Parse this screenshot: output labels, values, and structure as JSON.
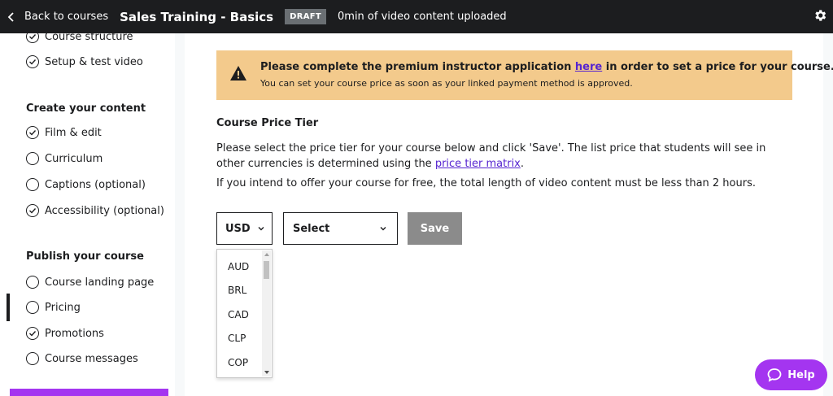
{
  "topbar": {
    "back_label": "Back to courses",
    "course_title": "Sales Training - Basics",
    "status_badge": "DRAFT",
    "video_status": "0min of video content uploaded"
  },
  "sidebar": {
    "plan_items": [
      {
        "label": "Course structure",
        "checked": true
      },
      {
        "label": "Setup & test video",
        "checked": true
      }
    ],
    "create_heading": "Create your content",
    "create_items": [
      {
        "label": "Film & edit",
        "checked": true
      },
      {
        "label": "Curriculum",
        "checked": false
      },
      {
        "label": "Captions (optional)",
        "checked": false
      },
      {
        "label": "Accessibility (optional)",
        "checked": true
      }
    ],
    "publish_heading": "Publish your course",
    "publish_items": [
      {
        "label": "Course landing page",
        "checked": false
      },
      {
        "label": "Pricing",
        "checked": false,
        "active": true
      },
      {
        "label": "Promotions",
        "checked": true
      },
      {
        "label": "Course messages",
        "checked": false
      }
    ]
  },
  "alert": {
    "title_before": "Please complete the premium instructor application ",
    "title_link": "here",
    "title_after": " in order to set a price for your course.",
    "subtext": "You can set your course price as soon as your linked payment method is approved."
  },
  "main": {
    "section_title": "Course Price Tier",
    "para1_before": "Please select the price tier for your course below and click 'Save'. The list price that students will see in other currencies is determined using the ",
    "para1_link": "price tier matrix",
    "para1_after": ".",
    "para2": "If you intend to offer your course for free, the total length of video content must be less than 2 hours.",
    "currency_value": "USD",
    "tier_value": "Select",
    "save_label": "Save",
    "currency_options": [
      "AUD",
      "BRL",
      "CAD",
      "CLP",
      "COP"
    ]
  },
  "help": {
    "label": "Help"
  },
  "colors": {
    "accent": "#a435f0",
    "link": "#5624d0",
    "alert_bg": "#f3ca8c",
    "topbar": "#1c1d1f"
  }
}
